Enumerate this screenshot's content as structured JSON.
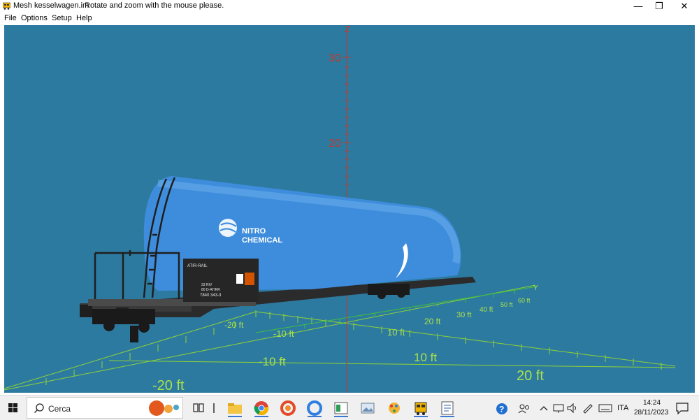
{
  "window": {
    "title": "Mesh kesselwagen.im",
    "hint": "Rotate and zoom with the mouse please.",
    "controls": {
      "minimize": "—",
      "restore": "❐",
      "close": "✕"
    }
  },
  "menu": [
    "File",
    "Options",
    "Setup",
    "Help"
  ],
  "viewport": {
    "background": "#2d7aa0",
    "z_axis": {
      "label": "Z",
      "ticks": [
        "30",
        "20"
      ]
    },
    "ground_grid": {
      "x_labels": [
        "-20 ft",
        "-10 ft",
        "10 ft",
        "20 ft"
      ],
      "y_label": "Y",
      "y_labels_near": [
        "-20 ft",
        "-10 ft",
        "10 ft",
        "20 ft"
      ],
      "y_labels_far": [
        "20 ft",
        "30 ft",
        "40 ft",
        "50 ft",
        "60 ft"
      ]
    },
    "model": {
      "tank_logo": [
        "NITRO",
        "CHEMICAL"
      ],
      "placard": [
        "ATIR-RAIL",
        "33 RIV",
        "80 D-ATIRR",
        "7840 343-3"
      ]
    }
  },
  "taskbar": {
    "search_placeholder": "Cerca",
    "apps": [
      "task-view",
      "divider",
      "file-explorer",
      "chrome",
      "app-red",
      "app-blue",
      "app-green",
      "app-photos",
      "app-paint",
      "app-train",
      "app-doc"
    ],
    "tray": {
      "language": "ITA",
      "time": "14:24",
      "date": "28/11/2023"
    }
  },
  "colors": {
    "tank": "#3e8ddc",
    "axis_z": "#c0392b",
    "grid": "#8ed334",
    "grid_y": "#3fbf3f"
  }
}
